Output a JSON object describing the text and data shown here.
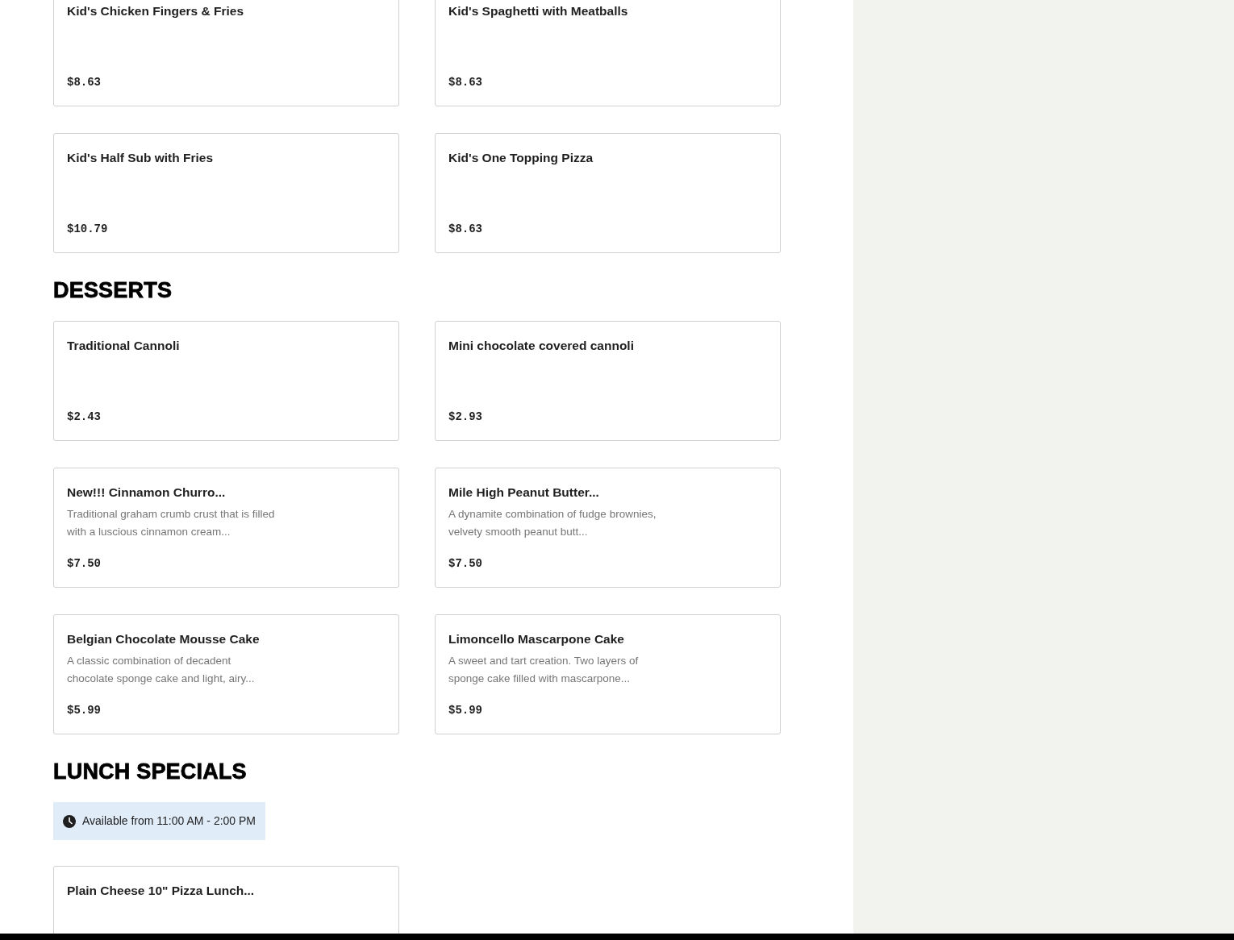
{
  "sections": [
    {
      "items": [
        {
          "name": "Kid's Chicken Fingers & Fries",
          "price": "$8.63"
        },
        {
          "name": "Kid's Spaghetti with Meatballs",
          "price": "$8.63"
        },
        {
          "name": "Kid's Half Sub with Fries",
          "price": "$10.79"
        },
        {
          "name": "Kid's One Topping Pizza",
          "price": "$8.63"
        }
      ]
    },
    {
      "title": "DESSERTS",
      "items": [
        {
          "name": "Traditional Cannoli",
          "price": "$2.43"
        },
        {
          "name": "Mini chocolate covered cannoli",
          "price": "$2.93"
        },
        {
          "name": "New!!! Cinnamon Churro...",
          "description": "Traditional graham crumb crust that is filled with a luscious cinnamon cream...",
          "price": "$7.50"
        },
        {
          "name": "Mile High Peanut Butter...",
          "description": "A dynamite combination of fudge brownies, velvety smooth peanut butt...",
          "price": "$7.50"
        },
        {
          "name": "Belgian Chocolate Mousse Cake",
          "description": "A classic combination of decadent chocolate sponge cake and light, airy...",
          "price": "$5.99"
        },
        {
          "name": "Limoncello Mascarpone Cake",
          "description": "A sweet and tart creation. Two layers of sponge cake filled with mascarpone...",
          "price": "$5.99"
        }
      ]
    },
    {
      "title": "LUNCH SPECIALS",
      "availability": "Available from 11:00 AM - 2:00 PM",
      "items": [
        {
          "name": "Plain Cheese 10\" Pizza Lunch..."
        }
      ]
    }
  ]
}
